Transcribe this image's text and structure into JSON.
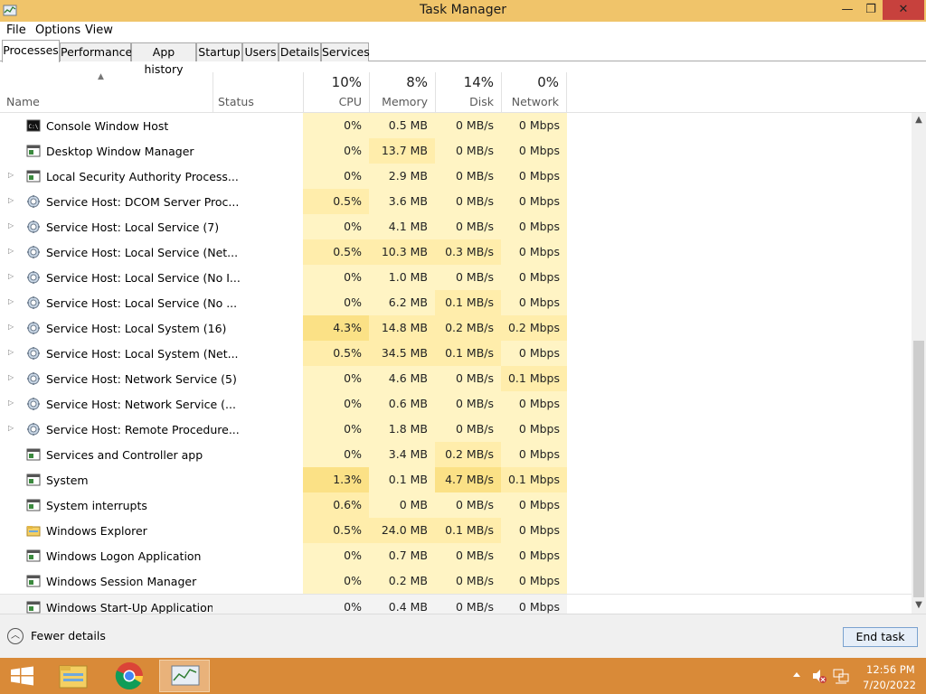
{
  "window": {
    "title": "Task Manager"
  },
  "window_controls": {
    "minimize": "—",
    "restore": "❐",
    "close": "✕"
  },
  "menu": [
    "File",
    "Options",
    "View"
  ],
  "tabs": [
    "Processes",
    "Performance",
    "App history",
    "Startup",
    "Users",
    "Details",
    "Services"
  ],
  "active_tab": "Processes",
  "columns": {
    "name": "Name",
    "status": "Status",
    "cpu": {
      "percent": "10%",
      "label": "CPU"
    },
    "memory": {
      "percent": "8%",
      "label": "Memory"
    },
    "disk": {
      "percent": "14%",
      "label": "Disk"
    },
    "network": {
      "percent": "0%",
      "label": "Network"
    }
  },
  "processes": [
    {
      "name": "Console Window Host",
      "cpu": "0%",
      "memory": "0.5 MB",
      "disk": "0 MB/s",
      "network": "0 Mbps",
      "icon": "console-icon",
      "expandable": false
    },
    {
      "name": "Desktop Window Manager",
      "cpu": "0%",
      "memory": "13.7 MB",
      "disk": "0 MB/s",
      "network": "0 Mbps",
      "icon": "window-app-icon",
      "expandable": false
    },
    {
      "name": "Local Security Authority Process...",
      "cpu": "0%",
      "memory": "2.9 MB",
      "disk": "0 MB/s",
      "network": "0 Mbps",
      "icon": "window-app-icon",
      "expandable": true
    },
    {
      "name": "Service Host: DCOM Server Proc...",
      "cpu": "0.5%",
      "memory": "3.6 MB",
      "disk": "0 MB/s",
      "network": "0 Mbps",
      "icon": "gear-icon",
      "expandable": true
    },
    {
      "name": "Service Host: Local Service (7)",
      "cpu": "0%",
      "memory": "4.1 MB",
      "disk": "0 MB/s",
      "network": "0 Mbps",
      "icon": "gear-icon",
      "expandable": true
    },
    {
      "name": "Service Host: Local Service (Net...",
      "cpu": "0.5%",
      "memory": "10.3 MB",
      "disk": "0.3 MB/s",
      "network": "0 Mbps",
      "icon": "gear-icon",
      "expandable": true
    },
    {
      "name": "Service Host: Local Service (No I...",
      "cpu": "0%",
      "memory": "1.0 MB",
      "disk": "0 MB/s",
      "network": "0 Mbps",
      "icon": "gear-icon",
      "expandable": true
    },
    {
      "name": "Service Host: Local Service (No ...",
      "cpu": "0%",
      "memory": "6.2 MB",
      "disk": "0.1 MB/s",
      "network": "0 Mbps",
      "icon": "gear-icon",
      "expandable": true
    },
    {
      "name": "Service Host: Local System (16)",
      "cpu": "4.3%",
      "memory": "14.8 MB",
      "disk": "0.2 MB/s",
      "network": "0.2 Mbps",
      "icon": "gear-icon",
      "expandable": true
    },
    {
      "name": "Service Host: Local System (Net...",
      "cpu": "0.5%",
      "memory": "34.5 MB",
      "disk": "0.1 MB/s",
      "network": "0 Mbps",
      "icon": "gear-icon",
      "expandable": true
    },
    {
      "name": "Service Host: Network Service (5)",
      "cpu": "0%",
      "memory": "4.6 MB",
      "disk": "0 MB/s",
      "network": "0.1 Mbps",
      "icon": "gear-icon",
      "expandable": true
    },
    {
      "name": "Service Host: Network Service (...",
      "cpu": "0%",
      "memory": "0.6 MB",
      "disk": "0 MB/s",
      "network": "0 Mbps",
      "icon": "gear-icon",
      "expandable": true
    },
    {
      "name": "Service Host: Remote Procedure...",
      "cpu": "0%",
      "memory": "1.8 MB",
      "disk": "0 MB/s",
      "network": "0 Mbps",
      "icon": "gear-icon",
      "expandable": true
    },
    {
      "name": "Services and Controller app",
      "cpu": "0%",
      "memory": "3.4 MB",
      "disk": "0.2 MB/s",
      "network": "0 Mbps",
      "icon": "window-app-icon",
      "expandable": false
    },
    {
      "name": "System",
      "cpu": "1.3%",
      "memory": "0.1 MB",
      "disk": "4.7 MB/s",
      "network": "0.1 Mbps",
      "icon": "window-app-icon",
      "expandable": false
    },
    {
      "name": "System interrupts",
      "cpu": "0.6%",
      "memory": "0 MB",
      "disk": "0 MB/s",
      "network": "0 Mbps",
      "icon": "window-app-icon",
      "expandable": false
    },
    {
      "name": "Windows Explorer",
      "cpu": "0.5%",
      "memory": "24.0 MB",
      "disk": "0.1 MB/s",
      "network": "0 Mbps",
      "icon": "folder-icon",
      "expandable": false
    },
    {
      "name": "Windows Logon Application",
      "cpu": "0%",
      "memory": "0.7 MB",
      "disk": "0 MB/s",
      "network": "0 Mbps",
      "icon": "window-app-icon",
      "expandable": false
    },
    {
      "name": "Windows Session Manager",
      "cpu": "0%",
      "memory": "0.2 MB",
      "disk": "0 MB/s",
      "network": "0 Mbps",
      "icon": "window-app-icon",
      "expandable": false
    },
    {
      "name": "Windows Start-Up Application",
      "cpu": "0%",
      "memory": "0.4 MB",
      "disk": "0 MB/s",
      "network": "0 Mbps",
      "icon": "window-app-icon",
      "expandable": false,
      "selected": true
    }
  ],
  "footer": {
    "fewer_details": "Fewer details",
    "end_task": "End task"
  },
  "taskbar": {
    "items": [
      "windows-start-icon",
      "file-explorer-icon",
      "chrome-icon",
      "task-manager-icon"
    ],
    "clock_time": "12:56 PM",
    "clock_date": "7/20/2022"
  },
  "colors": {
    "titlebar": "#f0c46a",
    "close_button": "#c7413d",
    "taskbar": "#d98a38",
    "heat_low": "#fff4c4",
    "heat_mid": "#ffedab",
    "heat_high": "#fbe186"
  }
}
